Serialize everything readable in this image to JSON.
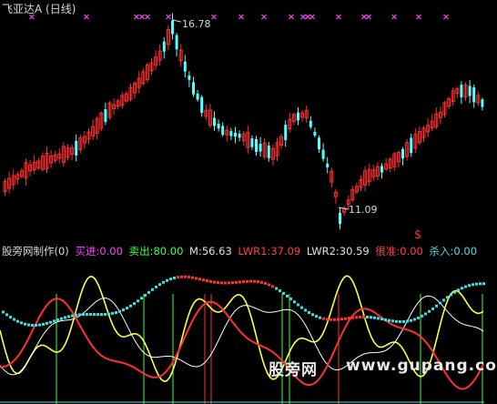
{
  "main": {
    "title": "飞亚达A (日线)",
    "high_label": "16.78",
    "low_label": "11.09",
    "signal_mark": "$"
  },
  "indicator": {
    "name": "股旁网制作(0)",
    "items": [
      {
        "label": "买进:0.00",
        "color": "#ff40ff"
      },
      {
        "label": "卖出:80.00",
        "color": "#40ff40"
      },
      {
        "label": "M:56.63",
        "color": "#e0e0e0"
      },
      {
        "label": "LWR1:37.09",
        "color": "#ff4040"
      },
      {
        "label": "LWR2:30.59",
        "color": "#e0e0e0"
      },
      {
        "label": "很准:0.00",
        "color": "#ff4040"
      },
      {
        "label": "杀入:0.00",
        "color": "#40e0e0"
      }
    ]
  },
  "watermark": {
    "left": "股旁网",
    "right": "www.gupang.com"
  },
  "colors": {
    "up": "#ff3030",
    "down": "#54ffff",
    "signal": "#ff40ff",
    "yellow": "#ffff40",
    "white": "#ffffff",
    "green": "#40ff40"
  }
}
